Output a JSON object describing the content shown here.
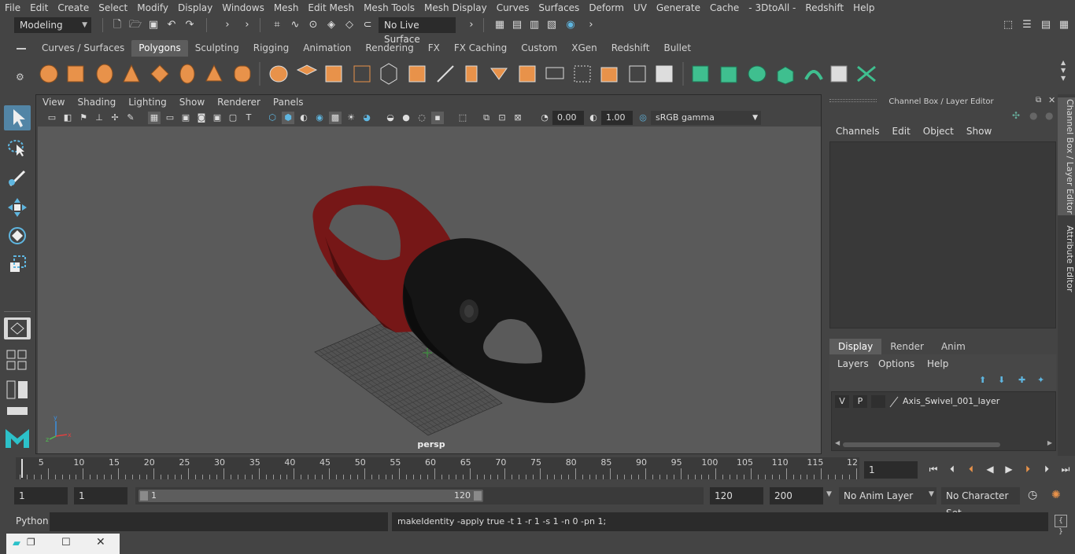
{
  "menubar": [
    "File",
    "Edit",
    "Create",
    "Select",
    "Modify",
    "Display",
    "Windows",
    "Mesh",
    "Edit Mesh",
    "Mesh Tools",
    "Mesh Display",
    "Curves",
    "Surfaces",
    "Deform",
    "UV",
    "Generate",
    "Cache",
    "- 3DtoAll -",
    "Redshift",
    "Help"
  ],
  "statusline": {
    "mode": "Modeling",
    "live_surface": "No Live Surface"
  },
  "shelf": {
    "tabs": [
      "Curves / Surfaces",
      "Polygons",
      "Sculpting",
      "Rigging",
      "Animation",
      "Rendering",
      "FX",
      "FX Caching",
      "Custom",
      "XGen",
      "Redshift",
      "Bullet"
    ],
    "active_tab": "Polygons"
  },
  "panel": {
    "menu": [
      "View",
      "Shading",
      "Lighting",
      "Show",
      "Renderer",
      "Panels"
    ],
    "exposure": "0.00",
    "gamma": "1.00",
    "color_space": "sRGB gamma",
    "camera": "persp"
  },
  "channelbox": {
    "title": "Channel Box / Layer Editor",
    "menu": [
      "Channels",
      "Edit",
      "Object",
      "Show"
    ],
    "layer_tabs": [
      "Display",
      "Render",
      "Anim"
    ],
    "active_layer_tab": "Display",
    "layer_menu": [
      "Layers",
      "Options",
      "Help"
    ],
    "layer": {
      "v": "V",
      "p": "P",
      "name": "Axis_Swivel_001_layer"
    }
  },
  "sidetabs": {
    "channel": "Channel Box / Layer Editor",
    "attribute": "Attribute Editor"
  },
  "timeslider": {
    "ticks": [
      "5",
      "10",
      "15",
      "20",
      "25",
      "30",
      "35",
      "40",
      "45",
      "50",
      "55",
      "60",
      "65",
      "70",
      "75",
      "80",
      "85",
      "90",
      "95",
      "100",
      "105",
      "110",
      "115",
      "12"
    ],
    "start_marker": "1",
    "current_frame": "1"
  },
  "range": {
    "start": "1",
    "playback_start": "1",
    "slider_start": "1",
    "slider_end": "120",
    "playback_end": "120",
    "end": "200",
    "anim_layer": "No Anim Layer",
    "char_set": "No Character Set"
  },
  "cmdline": {
    "language": "Python",
    "result": "makeIdentity -apply true -t 1 -r 1 -s 1 -n 0 -pn 1;"
  },
  "colors": {
    "accent_blue": "#5285a6",
    "shelf_orange": "#e8924a",
    "shelf_green": "#3fbf8f",
    "model_red": "#7a1a1a",
    "model_black": "#141414"
  }
}
